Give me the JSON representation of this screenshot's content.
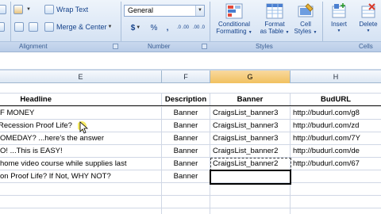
{
  "ribbon": {
    "alignment": {
      "wrap_text": "Wrap Text",
      "merge_center": "Merge & Center",
      "group_label": "Alignment"
    },
    "number": {
      "format_value": "General",
      "currency": "$",
      "percent": "%",
      "comma": ",",
      "dec_increase": ".0 .00",
      "dec_decrease": ".00 .0",
      "group_label": "Number"
    },
    "styles": {
      "conditional_formatting": [
        "Conditional",
        "Formatting"
      ],
      "format_as_table": [
        "Format",
        "as Table"
      ],
      "cell_styles": [
        "Cell",
        "Styles"
      ],
      "group_label": "Styles"
    },
    "cells": {
      "insert": "Insert",
      "delete": "Delete",
      "group_label": "Cells"
    }
  },
  "columns": [
    "E",
    "F",
    "G",
    "H"
  ],
  "table": {
    "headers": {
      "e": "Headline",
      "f": "Description",
      "g": "Banner",
      "h": "BudURL"
    },
    "rows": [
      {
        "e": "F MONEY",
        "f": "Banner",
        "g": "CraigsList_banner3",
        "h": "http://budurl.com/g8"
      },
      {
        "e": "Recession Proof Life?",
        "f": "Banner",
        "g": "CraigsList_banner3",
        "h": "http://budurl.com/zd"
      },
      {
        "e": "OMEDAY? ...here's the answer",
        "f": "Banner",
        "g": "CraigsList_banner3",
        "h": "http://budurl.com/7Y"
      },
      {
        "e": "O! ...This is EASY!",
        "f": "Banner",
        "g": "CraigsList_banner2",
        "h": "http://budurl.com/de"
      },
      {
        "e": "home video course while supplies last",
        "f": "Banner",
        "g": "CraigsList_banner2",
        "h": "http://budurl.com/67"
      },
      {
        "e": "on Proof Life? If Not, WHY NOT?",
        "f": "Banner",
        "g": "",
        "h": ""
      },
      {
        "e": "",
        "f": "",
        "g": "",
        "h": ""
      },
      {
        "e": "",
        "f": "",
        "g": "",
        "h": ""
      },
      {
        "e": "",
        "f": "",
        "g": "",
        "h": ""
      },
      {
        "e": "",
        "f": "",
        "g": "",
        "h": ""
      }
    ]
  }
}
